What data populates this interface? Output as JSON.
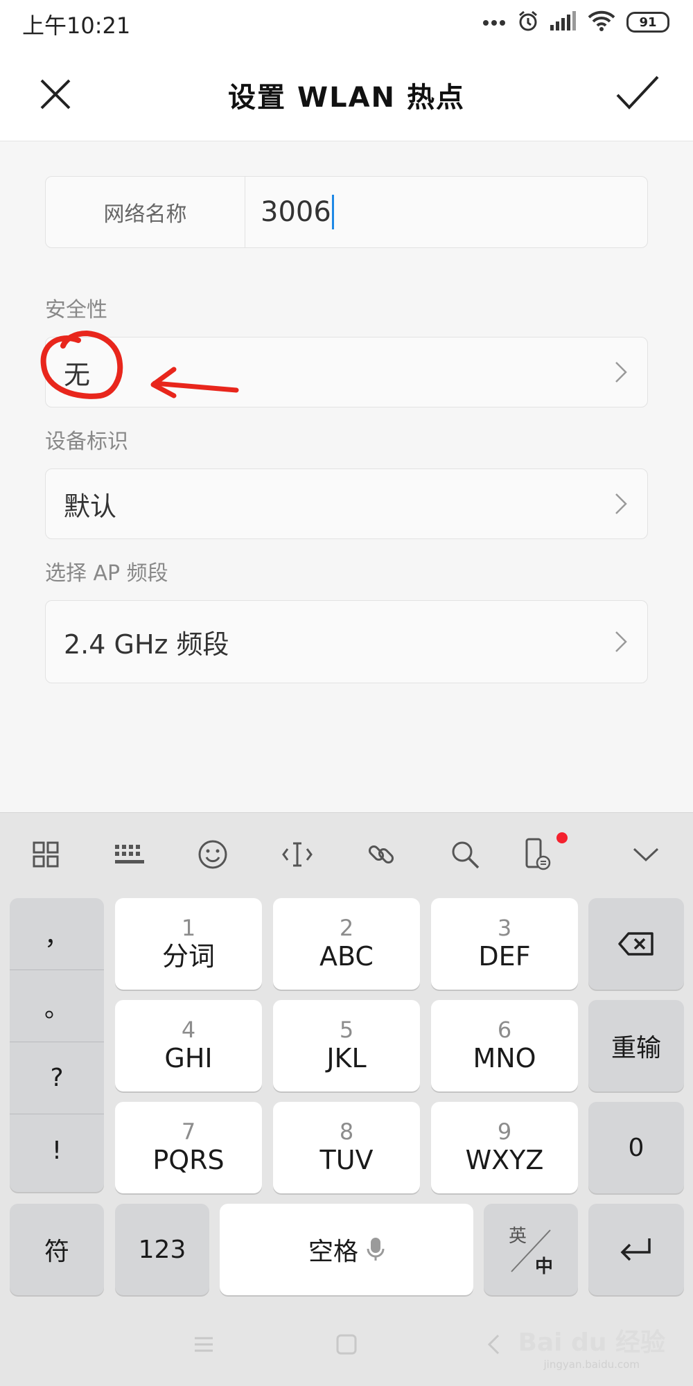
{
  "status_bar": {
    "time": "上午10:21",
    "battery": "91"
  },
  "header": {
    "title": "设置 WLAN 热点"
  },
  "form": {
    "network_name_label": "网络名称",
    "network_name_value": "3006",
    "security_label": "安全性",
    "security_value": "无",
    "device_id_label": "设备标识",
    "device_id_value": "默认",
    "ap_band_label": "选择 AP 频段",
    "ap_band_value": "2.4 GHz 频段"
  },
  "annotation": {
    "color": "#e8261c"
  },
  "keyboard": {
    "toolbar_icons": [
      "apps-grid-icon",
      "keyboard-icon",
      "emoji-icon",
      "text-cursor-icon",
      "link-icon",
      "search-icon",
      "phone-sync-icon",
      "collapse-icon"
    ],
    "punctuation": [
      "，",
      "。",
      "?",
      "!"
    ],
    "keys": [
      {
        "num": "1",
        "letters": "分词"
      },
      {
        "num": "2",
        "letters": "ABC"
      },
      {
        "num": "3",
        "letters": "DEF"
      },
      {
        "num": "4",
        "letters": "GHI"
      },
      {
        "num": "5",
        "letters": "JKL"
      },
      {
        "num": "6",
        "letters": "MNO"
      },
      {
        "num": "7",
        "letters": "PQRS"
      },
      {
        "num": "8",
        "letters": "TUV"
      },
      {
        "num": "9",
        "letters": "WXYZ"
      }
    ],
    "reinput_label": "重输",
    "zero_label": "0",
    "symbol_label": "符",
    "numeric_label": "123",
    "space_label": "空格",
    "lang_en": "英",
    "lang_zh": "中"
  },
  "watermark": {
    "brand": "Bai du 经验",
    "url": "jingyan.baidu.com"
  }
}
